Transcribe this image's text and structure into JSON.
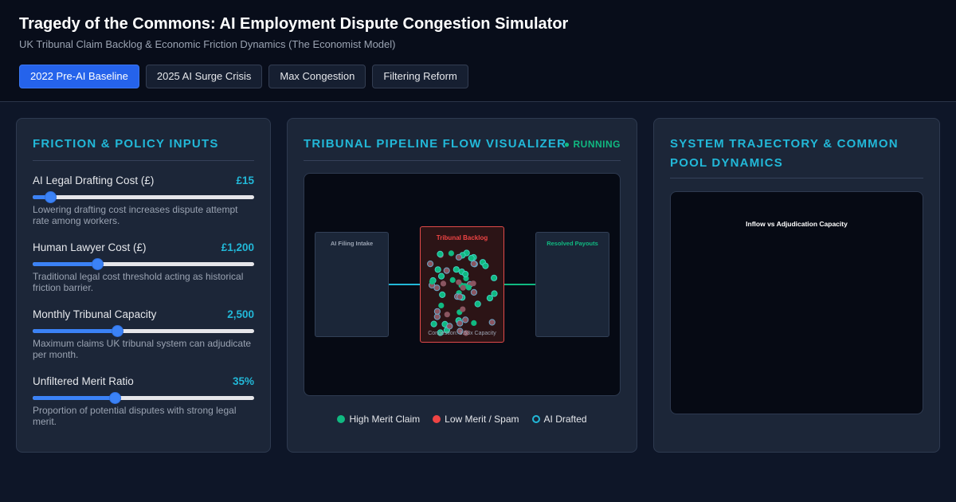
{
  "header": {
    "title": "Tragedy of the Commons: AI Employment Dispute Congestion Simulator",
    "subtitle": "UK Tribunal Claim Backlog & Economic Friction Dynamics (The Economist Model)",
    "tabs": [
      {
        "label": "2022 Pre-AI Baseline",
        "active": true
      },
      {
        "label": "2025 AI Surge Crisis",
        "active": false
      },
      {
        "label": "Max Congestion",
        "active": false
      },
      {
        "label": "Filtering Reform",
        "active": false
      }
    ]
  },
  "controls": {
    "title": "Friction & Policy Inputs",
    "items": [
      {
        "label": "AI Legal Drafting Cost (£)",
        "value": "£15",
        "slider_fraction": 0.08,
        "description": "Lowering drafting cost increases dispute attempt rate among workers."
      },
      {
        "label": "Human Lawyer Cost (£)",
        "value": "£1,200",
        "slider_fraction": 0.29,
        "description": "Traditional legal cost threshold acting as historical friction barrier."
      },
      {
        "label": "Monthly Tribunal Capacity",
        "value": "2,500",
        "slider_fraction": 0.38,
        "description": "Maximum claims UK tribunal system can adjudicate per month."
      },
      {
        "label": "Unfiltered Merit Ratio",
        "value": "35%",
        "slider_fraction": 0.37,
        "description": "Proportion of potential disputes with strong legal merit."
      }
    ]
  },
  "pipeline": {
    "title": "Tribunal Pipeline Flow Visualizer",
    "status": "● RUNNING",
    "intake_label": "AI Filing Intake",
    "backlog_label": "Tribunal Backlog",
    "payouts_label": "Resolved Payouts",
    "congestion_text": "Congestion: 3.53x Capacity",
    "legend": [
      {
        "label": "High Merit Claim",
        "color": "#10b981",
        "style": "filled"
      },
      {
        "label": "Low Merit / Spam",
        "color": "#ef4444",
        "style": "filled"
      },
      {
        "label": "AI Drafted",
        "color": "#22b8d8",
        "style": "ring"
      }
    ],
    "colors": {
      "high_merit": "#10b981",
      "low_merit": "#ef4444",
      "ai_ring": "#22b8d8",
      "backlog_border": "#e24a4a",
      "payouts": "#10b981"
    }
  },
  "trajectory": {
    "title": "System Trajectory & Common Pool Dynamics",
    "chart_title": "Inflow vs Adjudication Capacity"
  }
}
